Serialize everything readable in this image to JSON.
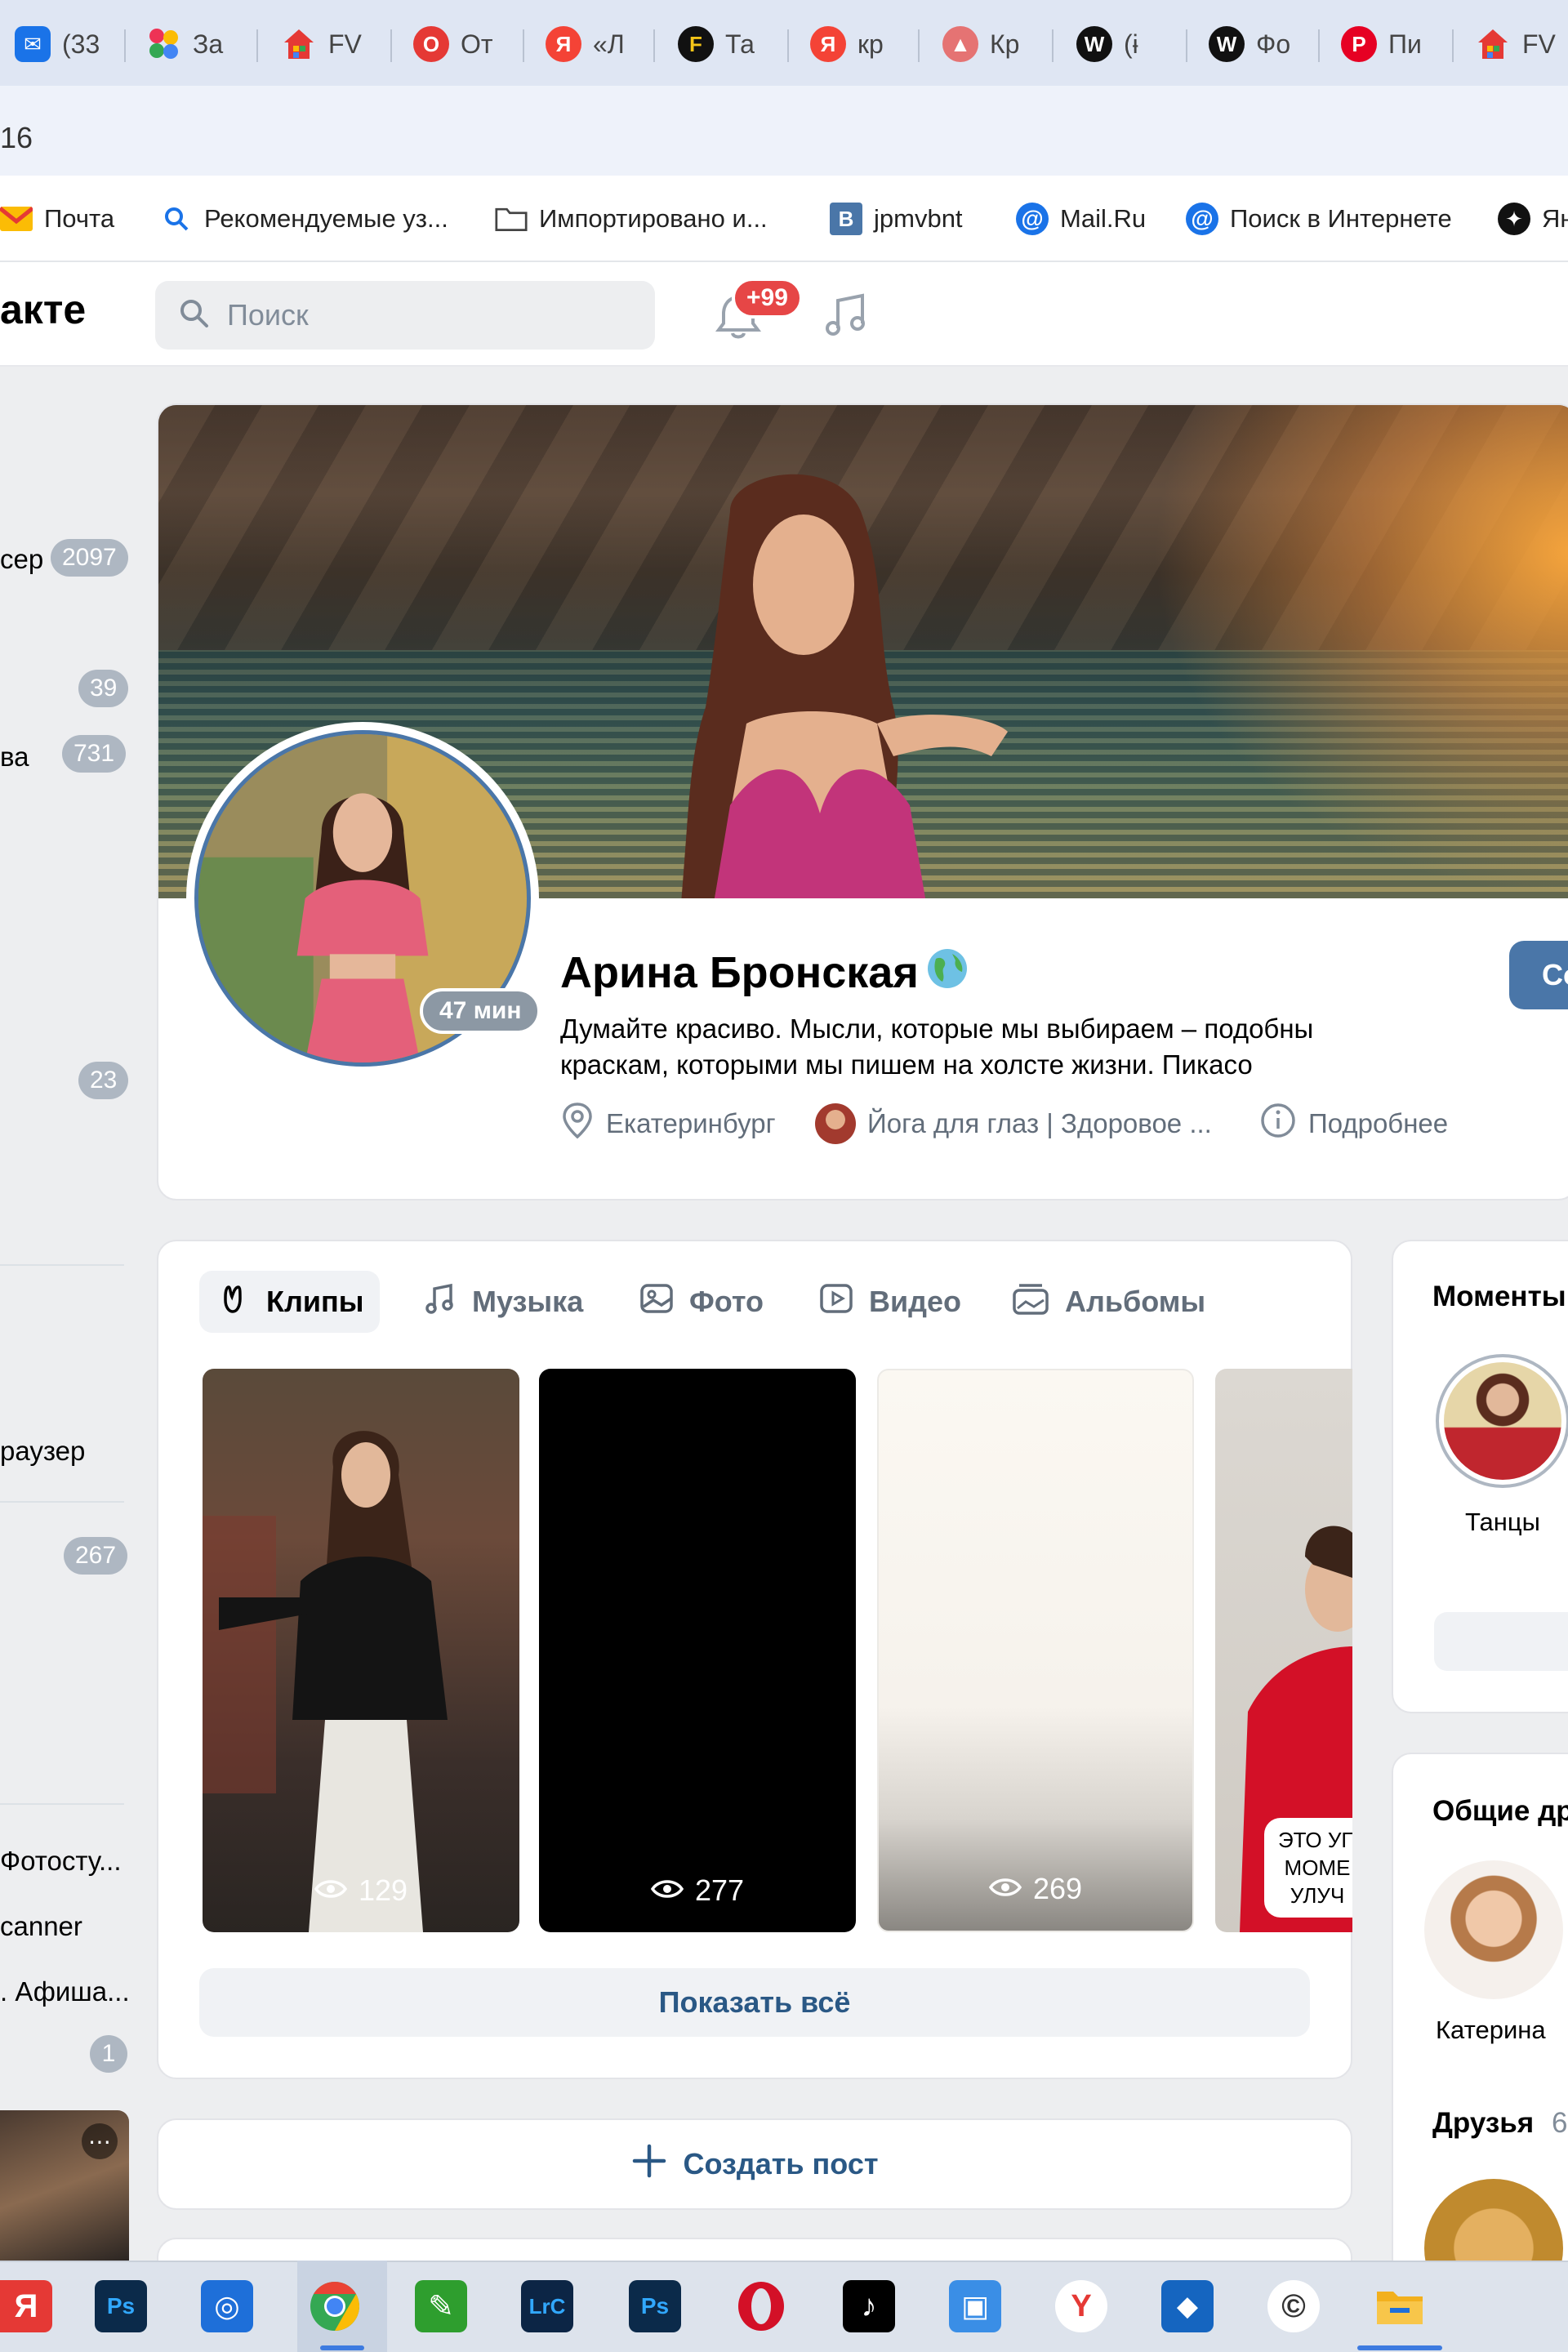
{
  "browser": {
    "tabs": [
      {
        "label": "(33",
        "icon": "mail-icon",
        "color": "#1a73e8"
      },
      {
        "label": "За",
        "icon": "dots-app-icon",
        "color": "#e35"
      },
      {
        "label": "FV",
        "icon": "house-icon",
        "color": "#4caf50"
      },
      {
        "label": "От",
        "icon": "opera-icon",
        "color": "#e53935"
      },
      {
        "label": "«Л",
        "icon": "yandex-icon",
        "color": "#f44336"
      },
      {
        "label": "Та",
        "icon": "f-icon",
        "color": "#111"
      },
      {
        "label": "кр",
        "icon": "yandex-icon",
        "color": "#f44336"
      },
      {
        "label": "Кр",
        "icon": "picture-icon",
        "color": "#e57373"
      },
      {
        "label": "(ɨ",
        "icon": "w-icon",
        "color": "#111"
      },
      {
        "label": "Фо",
        "icon": "w-icon",
        "color": "#111"
      },
      {
        "label": "Пи",
        "icon": "pinterest-icon",
        "color": "#e60023"
      },
      {
        "label": "FV",
        "icon": "house-icon",
        "color": "#4caf50"
      }
    ],
    "address_fragment": "16",
    "bookmarks": [
      {
        "label": "Почта",
        "icon": "mail-envelope-icon"
      },
      {
        "label": "Рекомендуемые уз...",
        "icon": "search-icon"
      },
      {
        "label": "Импортировано и...",
        "icon": "folder-icon"
      },
      {
        "label": "jpmvbnt",
        "icon": "b-icon"
      },
      {
        "label": "Mail.Ru",
        "icon": "at-icon"
      },
      {
        "label": "Поиск в Интернете",
        "icon": "at-icon"
      },
      {
        "label": "Ян",
        "icon": "star-icon"
      }
    ]
  },
  "header": {
    "logo_text": "акте",
    "search_placeholder": "Поиск",
    "notifications_badge": "+99"
  },
  "sidebar": {
    "items": [
      {
        "label": "сер",
        "count": "2097"
      },
      {
        "label": "",
        "count": "39"
      },
      {
        "label": "ва",
        "count": "731"
      },
      {
        "label": "",
        "count": "23"
      },
      {
        "label": "раузер",
        "count": ""
      },
      {
        "label": "",
        "count": "267"
      },
      {
        "label": "Фотосту...",
        "count": ""
      },
      {
        "label": "canner",
        "count": ""
      },
      {
        "label": ". Афиша...",
        "count": ""
      },
      {
        "label": "",
        "count": "1"
      }
    ]
  },
  "profile": {
    "name": "Арина Бронская",
    "status": "Думайте красиво. Мысли, которые мы выбираем – подобны краскам, которыми мы пишем на холсте жизни. Пикасо",
    "online_time": "47 мин",
    "city": "Екатеринбург",
    "group": "Йога для глаз | Здоровое ...",
    "more": "Подробнее",
    "action_label": "Co"
  },
  "media": {
    "tabs": [
      {
        "label": "Клипы",
        "icon": "clip-icon",
        "active": true
      },
      {
        "label": "Музыка",
        "icon": "music-note-icon",
        "active": false
      },
      {
        "label": "Фото",
        "icon": "photo-icon",
        "active": false
      },
      {
        "label": "Видео",
        "icon": "video-icon",
        "active": false
      },
      {
        "label": "Альбомы",
        "icon": "album-icon",
        "active": false
      }
    ],
    "clips": [
      {
        "views": "129"
      },
      {
        "views": "277"
      },
      {
        "views": "269"
      },
      {
        "views": "",
        "caption": "ЭТО УП МОМЕ УЛУЧ"
      }
    ],
    "show_all": "Показать всё"
  },
  "create_post": "Создать пост",
  "right": {
    "moments_title": "Моменты",
    "moment_label": "Танцы",
    "common_friends_title": "Общие др",
    "friend_name": "Катерина",
    "friends_title": "Друзья",
    "friends_count": "6"
  },
  "taskbar": {
    "apps": [
      {
        "name": "yandex-browser-icon",
        "label": "Я",
        "color": "#e53935"
      },
      {
        "name": "photoshop-icon",
        "label": "Ps",
        "color": "#0b2a4a"
      },
      {
        "name": "camera-app-icon",
        "label": "◎",
        "color": "#1e6fd9"
      },
      {
        "name": "chrome-icon",
        "label": "◉",
        "color": "#34a853"
      },
      {
        "name": "pen-app-icon",
        "label": "✎",
        "color": "#2e9e2e"
      },
      {
        "name": "lightroom-icon",
        "label": "LrC",
        "color": "#0c2545"
      },
      {
        "name": "photoshop-icon-2",
        "label": "Ps",
        "color": "#0b2a4a"
      },
      {
        "name": "opera-icon",
        "label": "O",
        "color": "#d31027"
      },
      {
        "name": "tiktok-icon",
        "label": "♪",
        "color": "#000"
      },
      {
        "name": "screen-app-icon",
        "label": "▣",
        "color": "#3a8ee6"
      },
      {
        "name": "yandex-icon",
        "label": "Y",
        "color": "#e53935"
      },
      {
        "name": "shield-app-icon",
        "label": "◆",
        "color": "#1565c0"
      },
      {
        "name": "circle-app-icon",
        "label": "©",
        "color": "#333"
      },
      {
        "name": "file-explorer-icon",
        "label": "▬",
        "color": "#f2b01e"
      }
    ]
  },
  "colors": {
    "accent": "#4a76a8",
    "link": "#2a5885",
    "badge_red": "#e64646",
    "background": "#edeef0"
  }
}
